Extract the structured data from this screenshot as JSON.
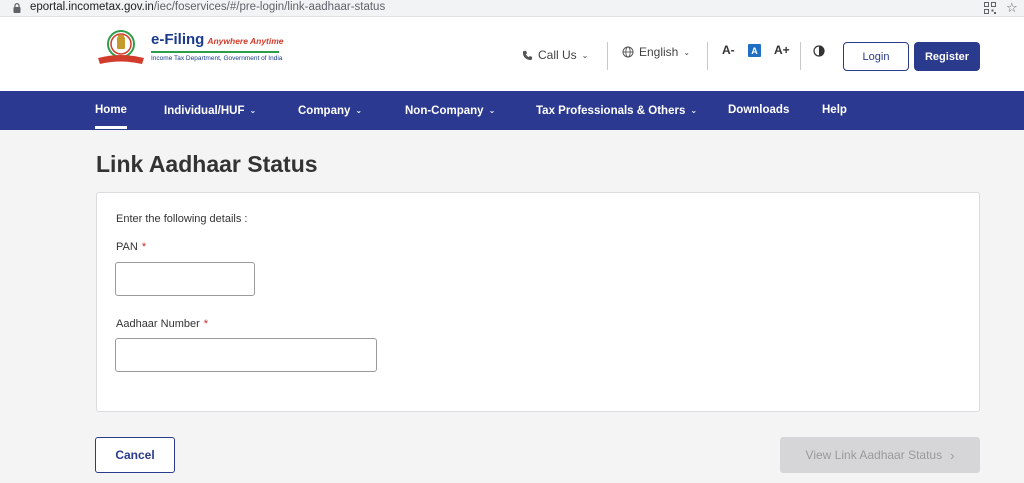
{
  "browser": {
    "url_host": "eportal.incometax.gov.in",
    "url_path": "/iec/foservices/#/pre-login/link-aadhaar-status"
  },
  "header": {
    "logo_title": "e-Filing",
    "logo_tagline": "Anywhere Anytime",
    "logo_subtitle": "Income Tax Department, Government of India",
    "call_us": "Call Us",
    "language": "English",
    "font_small": "A-",
    "font_normal": "A",
    "font_large": "A+",
    "login": "Login",
    "register": "Register"
  },
  "nav": {
    "items": [
      {
        "label": "Home",
        "dropdown": false
      },
      {
        "label": "Individual/HUF",
        "dropdown": true
      },
      {
        "label": "Company",
        "dropdown": true
      },
      {
        "label": "Non-Company",
        "dropdown": true
      },
      {
        "label": "Tax Professionals & Others",
        "dropdown": true
      },
      {
        "label": "Downloads",
        "dropdown": false
      },
      {
        "label": "Help",
        "dropdown": false
      }
    ]
  },
  "page": {
    "title": "Link Aadhaar Status",
    "intro": "Enter the following details :",
    "pan_label": "PAN",
    "aadhaar_label": "Aadhaar Number",
    "required_mark": "*",
    "pan_value": "",
    "aadhaar_value": ""
  },
  "actions": {
    "cancel": "Cancel",
    "view_status": "View Link Aadhaar Status"
  },
  "colors": {
    "nav_bg": "#2b3990",
    "brand_blue": "#2a3a8c",
    "disabled_button": "#d6d6d8",
    "required": "#c62828"
  }
}
